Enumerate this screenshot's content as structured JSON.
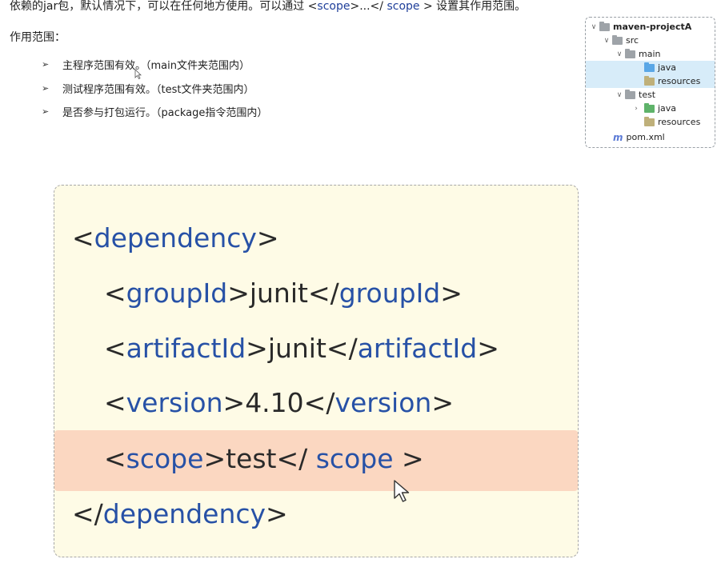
{
  "intro": {
    "text_a": "依赖的jar包，默认情况下，可以在任何地方使用。可以通过 <",
    "scope_kw_1": "scope",
    "text_b": ">...</",
    "scope_kw_2": " scope",
    "text_c": " > 设置其作用范围。"
  },
  "scope_heading": "作用范围：",
  "bullets": [
    "主程序范围有效。（main文件夹范围内）",
    "测试程序范围有效。（test文件夹范围内）",
    "是否参与打包运行。（package指令范围内）"
  ],
  "tree": {
    "project": "maven-projectA",
    "src": "src",
    "main": "main",
    "main_java": "java",
    "main_resources": "resources",
    "test": "test",
    "test_java": "java",
    "test_resources": "resources",
    "pom_icon": "m",
    "pom": "pom.xml"
  },
  "code": {
    "dependency_open": "dependency",
    "groupId_tag": "groupId",
    "groupId_value": "junit",
    "artifactId_tag": "artifactId",
    "artifactId_value": "junit",
    "version_tag": "version",
    "version_value": "4.10",
    "scope_tag": "scope",
    "scope_value": "test",
    "scope_close_tag": " scope ",
    "dependency_close": "dependency"
  },
  "colors": {
    "tag": "#2751a6",
    "card_bg": "#fefbe6",
    "highlight": "#fbd7c1",
    "tree_selected": "#d7ecf9"
  }
}
